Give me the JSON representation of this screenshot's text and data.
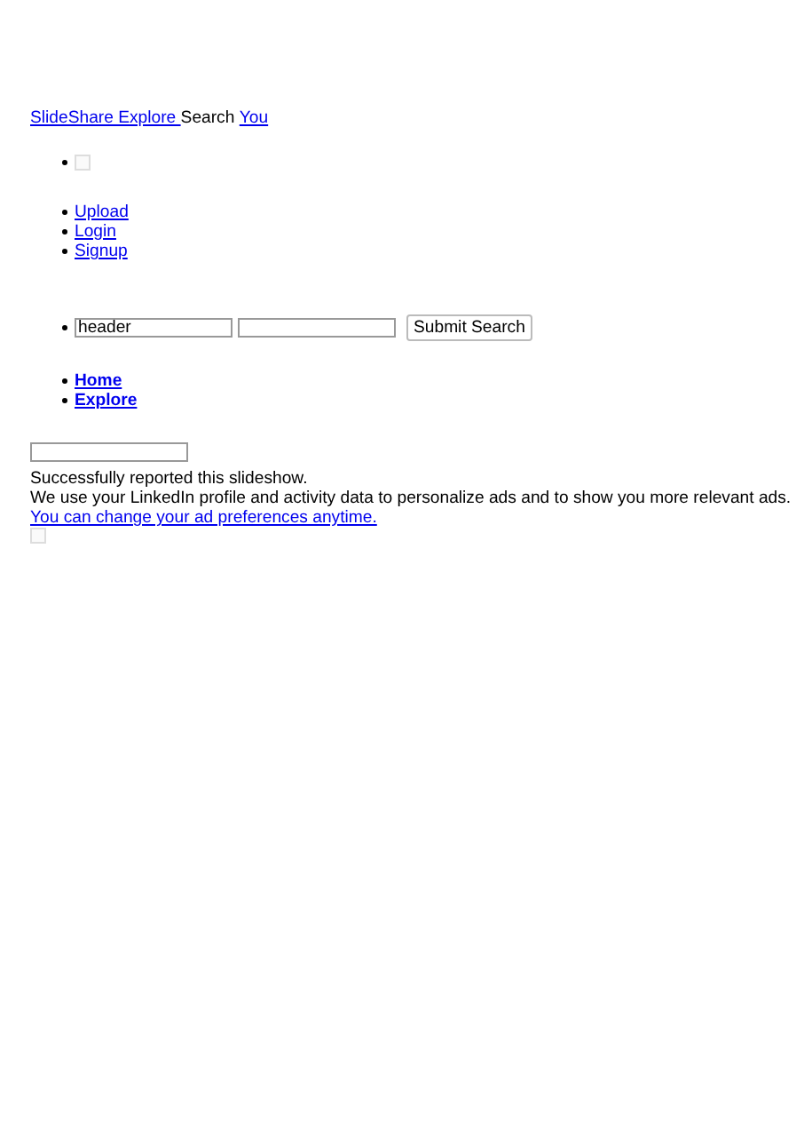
{
  "top_nav": [
    {
      "label": "SlideShare Explore ",
      "kind": "link"
    },
    {
      "label": "Search",
      "kind": "text"
    },
    {
      "label": "You",
      "kind": "link"
    }
  ],
  "account_links": [
    "Upload",
    "Login",
    "Signup"
  ],
  "search": {
    "value": "header",
    "button": "Submit Search"
  },
  "main_nav": [
    "Home",
    "Explore"
  ],
  "messages": {
    "reported": "Successfully reported this slideshow.",
    "ads_notice": "We use your LinkedIn profile and activity data to personalize ads and to show you more relevant ads.",
    "preferences_link": "You can change your ad preferences anytime."
  }
}
